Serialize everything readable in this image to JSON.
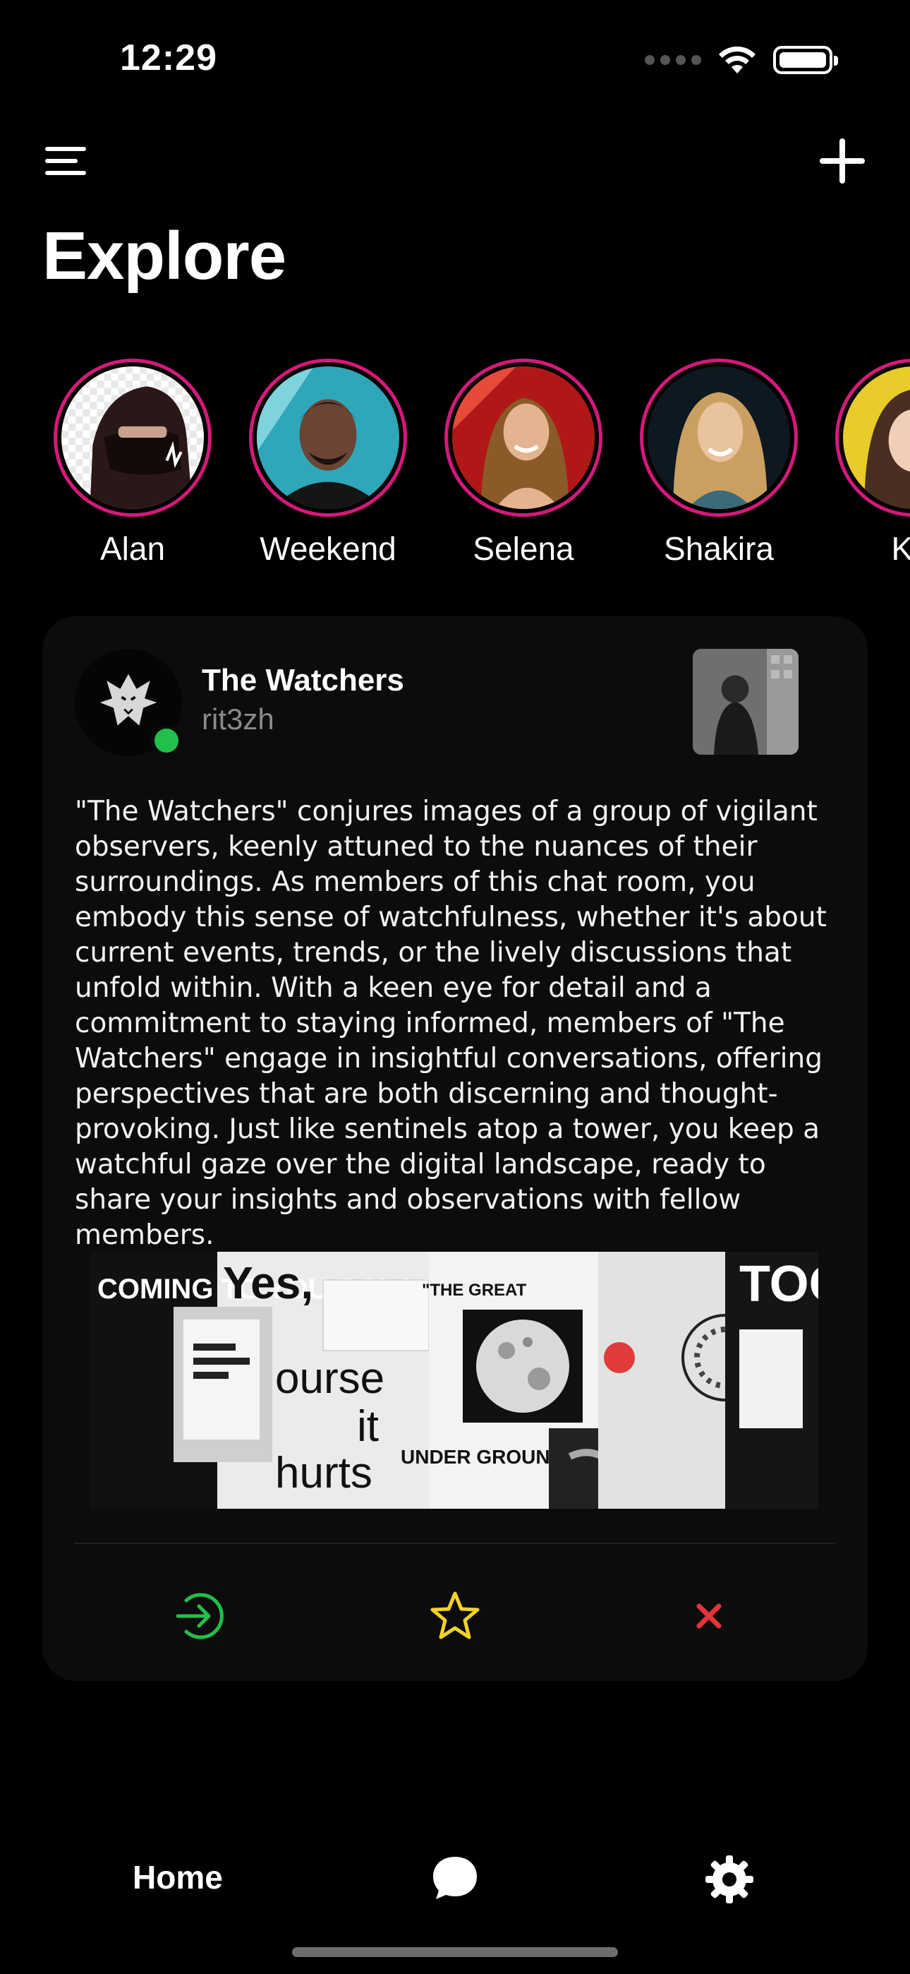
{
  "status_bar": {
    "time": "12:29"
  },
  "header": {
    "title": "Explore"
  },
  "stories": [
    {
      "name": "Alan"
    },
    {
      "name": "Weekend"
    },
    {
      "name": "Selena"
    },
    {
      "name": "Shakira"
    },
    {
      "name": "K'n"
    }
  ],
  "card": {
    "title": "The Watchers",
    "handle": "rit3zh",
    "description": "\"The Watchers\" conjures images of a group of vigilant observers, keenly attuned to the nuances of their surroundings. As members of this chat room, you embody this sense of watchfulness, whether it's about current events, trends, or the lively discussions that unfold within. With a keen eye for detail and a commitment to staying informed, members of \"The Watchers\" engage in insightful conversations, offering perspectives that are both discerning and thought-provoking. Just like sentinels atop a tower, you keep a watchful gaze over the digital landscape, ready to share your insights and observations with fellow members.",
    "online": true,
    "collage_text": {
      "coming": "COMING TO YOU GALA THI SUMM",
      "yes": "Yes,",
      "ourse": "ourse",
      "it": "it",
      "hurts": "hurts",
      "the_great": "\"THE GREAT",
      "under_ground": "UNDER GROUND\"",
      "too": "TOO"
    },
    "actions": [
      {
        "name": "join",
        "icon": "enter-icon",
        "color": "#22c04a"
      },
      {
        "name": "favorite",
        "icon": "star-icon",
        "color": "#f2d22a"
      },
      {
        "name": "dismiss",
        "icon": "close-icon",
        "color": "#e5333b"
      }
    ]
  },
  "bottom_nav": {
    "home_label": "Home"
  },
  "colors": {
    "story_ring": "#d4197a",
    "online": "#22c04a",
    "card_bg": "#0c0c0c"
  }
}
